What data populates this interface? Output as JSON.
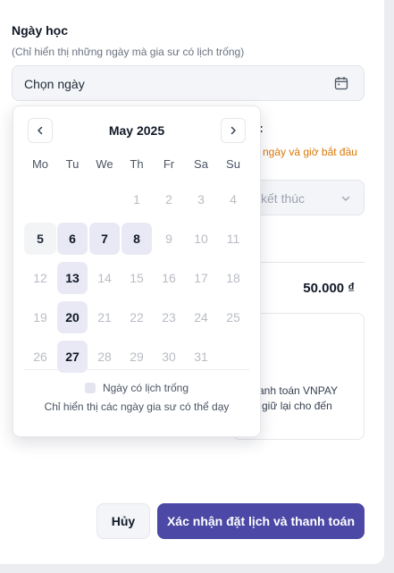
{
  "form": {
    "date_label": "Ngày học",
    "date_hint": "(Chỉ hiển thị những ngày mà gia sư có lịch trống)",
    "date_value": "Chọn ngày",
    "behind": {
      "label_tail": ":",
      "warning_text": "ngày và giờ bắt đầu",
      "select_text": "kết thúc",
      "price": "50.000 ₫",
      "card_line1": "anh toán VNPAY",
      "card_line2": "giữ lại cho đến"
    }
  },
  "calendar": {
    "month_title": "May 2025",
    "weekdays": [
      "Mo",
      "Tu",
      "We",
      "Th",
      "Fr",
      "Sa",
      "Su"
    ],
    "days": [
      {
        "label": "",
        "state": "empty"
      },
      {
        "label": "",
        "state": "empty"
      },
      {
        "label": "",
        "state": "empty"
      },
      {
        "label": "1",
        "state": "disabled"
      },
      {
        "label": "2",
        "state": "disabled"
      },
      {
        "label": "3",
        "state": "disabled"
      },
      {
        "label": "4",
        "state": "disabled"
      },
      {
        "label": "5",
        "state": "today"
      },
      {
        "label": "6",
        "state": "available"
      },
      {
        "label": "7",
        "state": "available"
      },
      {
        "label": "8",
        "state": "available"
      },
      {
        "label": "9",
        "state": "disabled"
      },
      {
        "label": "10",
        "state": "disabled"
      },
      {
        "label": "11",
        "state": "disabled"
      },
      {
        "label": "12",
        "state": "disabled"
      },
      {
        "label": "13",
        "state": "available"
      },
      {
        "label": "14",
        "state": "disabled"
      },
      {
        "label": "15",
        "state": "disabled"
      },
      {
        "label": "16",
        "state": "disabled"
      },
      {
        "label": "17",
        "state": "disabled"
      },
      {
        "label": "18",
        "state": "disabled"
      },
      {
        "label": "19",
        "state": "disabled"
      },
      {
        "label": "20",
        "state": "available"
      },
      {
        "label": "21",
        "state": "disabled"
      },
      {
        "label": "22",
        "state": "disabled"
      },
      {
        "label": "23",
        "state": "disabled"
      },
      {
        "label": "24",
        "state": "disabled"
      },
      {
        "label": "25",
        "state": "disabled"
      },
      {
        "label": "26",
        "state": "disabled"
      },
      {
        "label": "27",
        "state": "available"
      },
      {
        "label": "28",
        "state": "disabled"
      },
      {
        "label": "29",
        "state": "disabled"
      },
      {
        "label": "30",
        "state": "disabled"
      },
      {
        "label": "31",
        "state": "disabled"
      }
    ],
    "legend_label": "Ngày có lịch trống",
    "legend_note": "Chỉ hiển thị các ngày gia sư có thể dạy"
  },
  "footer": {
    "cancel_label": "Hủy",
    "confirm_label": "Xác nhận đặt lịch và thanh toán"
  },
  "colors": {
    "primary": "#4b48a6",
    "available_bg": "#e9e9f6",
    "warning": "#d97706"
  },
  "icons": {
    "date_input": "calendar-icon",
    "prev": "chevron-left-icon",
    "next": "chevron-right-icon",
    "select": "chevron-down-icon"
  }
}
